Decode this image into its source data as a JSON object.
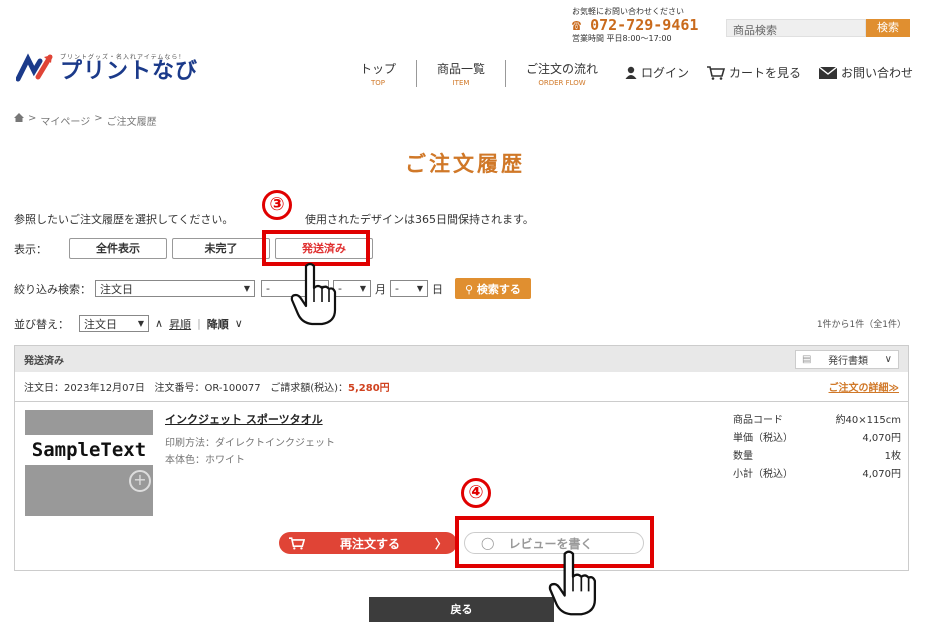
{
  "header": {
    "contact_note": "お気軽にお問い合わせください",
    "phone": "072-729-9461",
    "hours": "営業時間 平日8:00～17:00",
    "search_placeholder": "商品検索",
    "search_button": "検索",
    "logo_tagline": "プリントグッズ・名入れアイテムなら！",
    "logo_name": "プリントなび"
  },
  "gnav": [
    {
      "jp": "トップ",
      "en": "TOP"
    },
    {
      "jp": "商品一覧",
      "en": "ITEM"
    },
    {
      "jp": "ご注文の流れ",
      "en": "ORDER FLOW"
    }
  ],
  "unav": {
    "login": "ログイン",
    "cart": "カートを見る",
    "contact": "お問い合わせ"
  },
  "breadcrumb": {
    "sep": ">",
    "mypage": "マイページ",
    "current": "ご注文履歴"
  },
  "page_title": "ご注文履歴",
  "intro": {
    "left": "参照したいご注文履歴を選択してください。",
    "right": "使用されたデザインは365日間保持されます。"
  },
  "filter": {
    "label": "表示：",
    "all": "全件表示",
    "incomplete": "未完了",
    "shipped": "発送済み"
  },
  "narrow": {
    "label": "絞り込み検索：",
    "field": "注文日",
    "year": "-",
    "month": "-",
    "month_unit": "月",
    "day": "-",
    "day_unit": "日",
    "button": "検索する"
  },
  "sort": {
    "label": "並び替え：",
    "field": "注文日",
    "asc": "昇順",
    "desc": "降順",
    "count": "1件から1件（全1件）"
  },
  "order": {
    "status": "発送済み",
    "doc_select": "発行書類",
    "date_label": "注文日：",
    "date": "2023年12月07日",
    "number_label": "注文番号：",
    "number": "OR-100077",
    "amount_label": "ご請求額(税込)：",
    "amount": "5,280円",
    "detail_link": "ご注文の詳細≫",
    "product": {
      "thumb_text": "SampleText",
      "name": "インクジェット スポーツタオル",
      "method": "印刷方法：ダイレクトインクジェット",
      "color": "本体色：ホワイト"
    },
    "specs": [
      {
        "label": "商品コード",
        "value": "約40×115cm"
      },
      {
        "label": "単価（税込）",
        "value": "4,070円"
      },
      {
        "label": "数量",
        "value": "1枚"
      },
      {
        "label": "小計（税込）",
        "value": "4,070円"
      }
    ],
    "reorder_button": "再注文する",
    "review_button": "レビューを書く"
  },
  "back_button": "戻る",
  "annotations": {
    "step3": "③",
    "step4": "④"
  },
  "colors": {
    "accent_orange": "#d07828",
    "button_orange": "#e08f30",
    "reorder_red": "#e04436",
    "annotation_red": "#e00000",
    "logo_blue": "#1b3a8a"
  }
}
